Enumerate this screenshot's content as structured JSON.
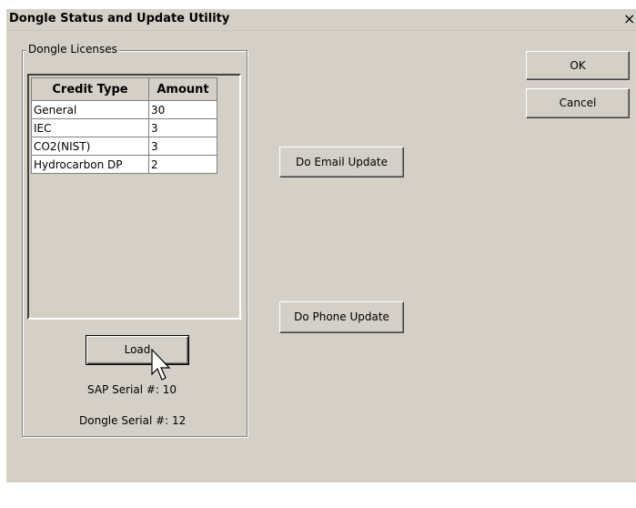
{
  "window": {
    "title": "Dongle Status and Update Utility",
    "close_glyph": "×"
  },
  "group": {
    "label": "Dongle Licenses"
  },
  "table": {
    "headers": [
      "Credit Type",
      "Amount"
    ],
    "rows": [
      [
        "General",
        "30"
      ],
      [
        "IEC",
        "3"
      ],
      [
        "CO2(NIST)",
        "3"
      ],
      [
        "Hydrocarbon DP",
        "2"
      ]
    ]
  },
  "buttons": {
    "load": "Load",
    "ok": "OK",
    "cancel": "Cancel",
    "email_update": "Do Email Update",
    "phone_update": "Do Phone Update"
  },
  "info": {
    "sap_serial": "SAP Serial #: 10",
    "dongle_serial": "Dongle Serial #: 12"
  },
  "icons": {
    "cursor": "mouse-pointer-icon"
  }
}
